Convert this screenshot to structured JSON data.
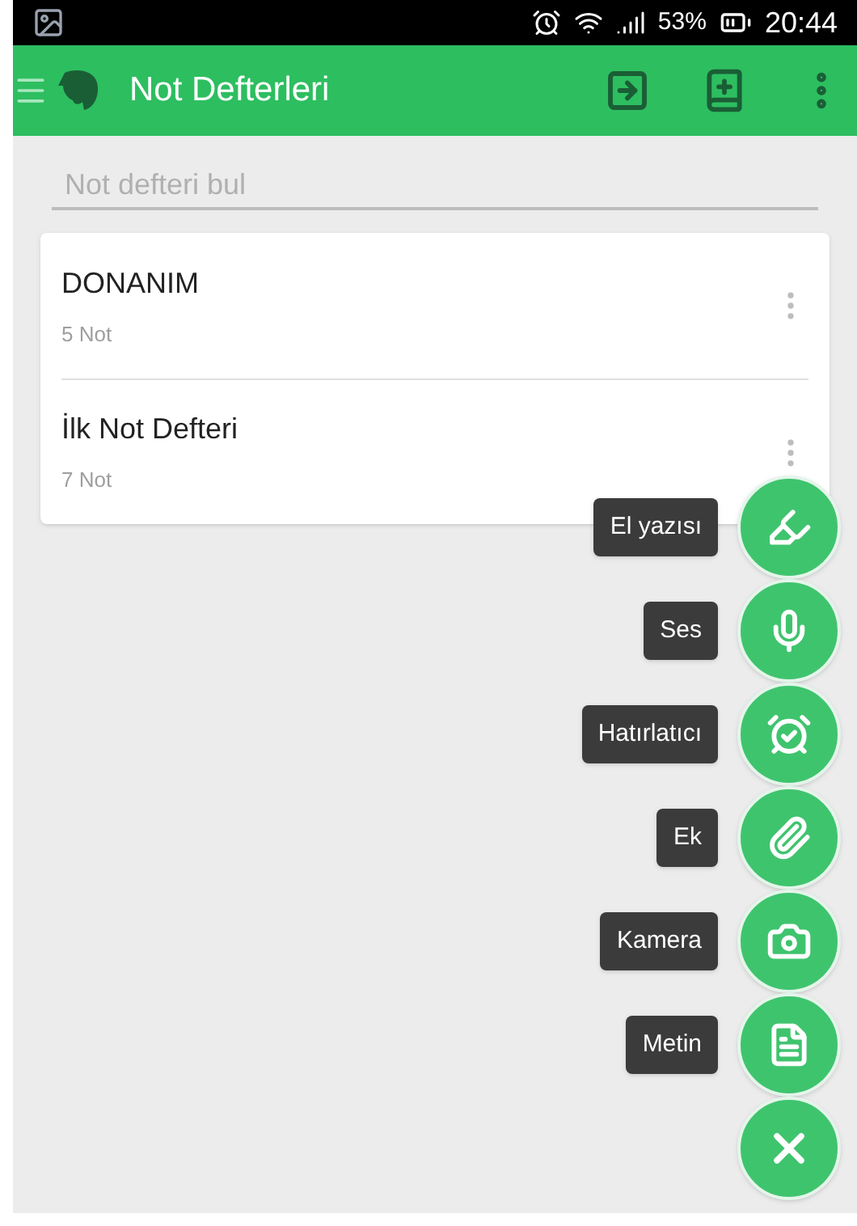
{
  "status_bar": {
    "battery": "53%",
    "time": "20:44"
  },
  "app_bar": {
    "title": "Not Defterleri"
  },
  "search": {
    "placeholder": "Not defteri bul"
  },
  "notebooks": [
    {
      "name": "DONANIM",
      "count": "5 Not"
    },
    {
      "name": "İlk Not Defteri",
      "count": "7 Not"
    }
  ],
  "fab_actions": [
    {
      "label": "El yazısı",
      "kind": "handwriting"
    },
    {
      "label": "Ses",
      "kind": "audio"
    },
    {
      "label": "Hatırlatıcı",
      "kind": "reminder"
    },
    {
      "label": "Ek",
      "kind": "attachment"
    },
    {
      "label": "Kamera",
      "kind": "camera"
    },
    {
      "label": "Metin",
      "kind": "text"
    }
  ]
}
